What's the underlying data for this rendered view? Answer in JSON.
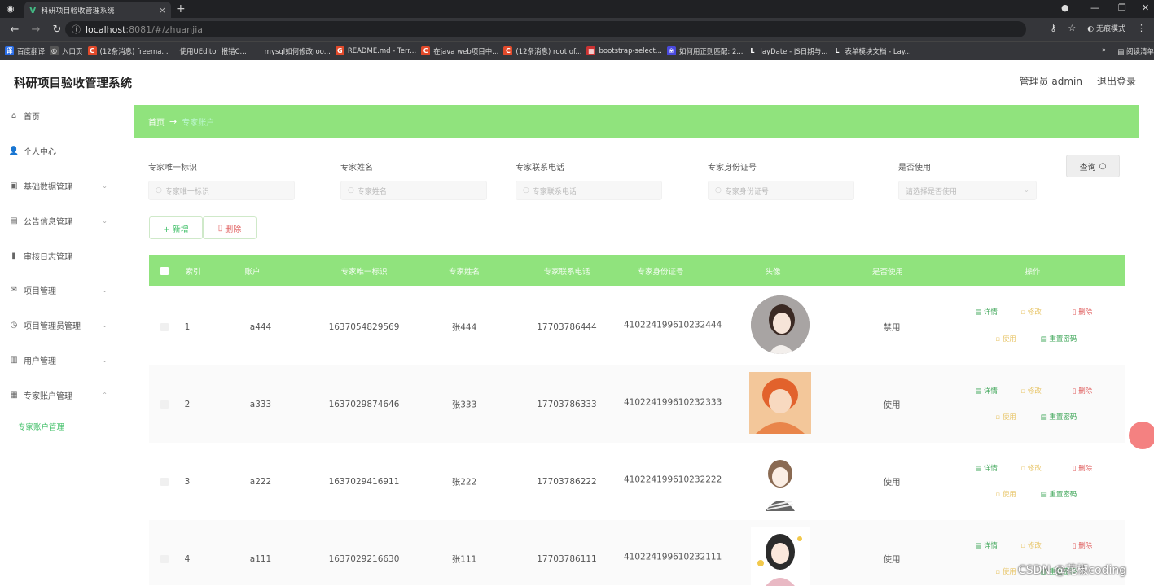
{
  "browser": {
    "tab_title": "科研项目验收管理系统",
    "tab_icon": "V",
    "url_host": "localhost",
    "url_rest": ":8081/#/zhuanjia",
    "incognito_label": "无痕模式",
    "bookmarks": [
      "百度翻译",
      "入口页",
      "(12条消息) freema...",
      "使用UEditor 报错C...",
      "mysql如何修改roo...",
      "README.md - Terr...",
      "在java web项目中...",
      "(12条消息) root of...",
      "bootstrap-select...",
      "如何用正则匹配: 2...",
      "layDate - JS日期与...",
      "表单模块文档 - Lay..."
    ],
    "bookmarks_more": "»",
    "reading_list": "阅读清单"
  },
  "header": {
    "title": "科研项目验收管理系统",
    "user": "管理员 admin",
    "logout": "退出登录"
  },
  "sidebar": {
    "items": [
      {
        "label": "首页",
        "icon": "home-icon"
      },
      {
        "label": "个人中心",
        "icon": "user-icon"
      },
      {
        "label": "基础数据管理",
        "icon": "data-icon"
      },
      {
        "label": "公告信息管理",
        "icon": "notice-icon"
      },
      {
        "label": "审核日志管理",
        "icon": "chart-icon"
      },
      {
        "label": "项目管理",
        "icon": "mail-icon"
      },
      {
        "label": "项目管理员管理",
        "icon": "clock-icon"
      },
      {
        "label": "用户管理",
        "icon": "users-icon"
      },
      {
        "label": "专家账户管理",
        "icon": "expert-icon"
      }
    ],
    "sub_item": "专家账户管理"
  },
  "breadcrumb": {
    "home": "首页",
    "sep": "→",
    "current": "专家账户"
  },
  "search": {
    "fields": [
      {
        "label": "专家唯一标识",
        "placeholder": "专家唯一标识"
      },
      {
        "label": "专家姓名",
        "placeholder": "专家姓名"
      },
      {
        "label": "专家联系电话",
        "placeholder": "专家联系电话"
      },
      {
        "label": "专家身份证号",
        "placeholder": "专家身份证号"
      },
      {
        "label": "是否使用",
        "placeholder": "请选择是否使用"
      }
    ],
    "query_label": "查询"
  },
  "actions": {
    "add": "+ 新增",
    "delete": "删除"
  },
  "table": {
    "headers": [
      "索引",
      "账户",
      "专家唯一标识",
      "专家姓名",
      "专家联系电话",
      "专家身份证号",
      "头像",
      "是否使用",
      "操作"
    ],
    "rows": [
      {
        "index": "1",
        "account": "a444",
        "uid": "1637054829569",
        "name": "张444",
        "phone": "17703786444",
        "idcard": "410224199610232444",
        "status": "禁用"
      },
      {
        "index": "2",
        "account": "a333",
        "uid": "1637029874646",
        "name": "张333",
        "phone": "17703786333",
        "idcard": "410224199610232333",
        "status": "使用"
      },
      {
        "index": "3",
        "account": "a222",
        "uid": "1637029416911",
        "name": "张222",
        "phone": "17703786222",
        "idcard": "410224199610232222",
        "status": "使用"
      },
      {
        "index": "4",
        "account": "a111",
        "uid": "1637029216630",
        "name": "张111",
        "phone": "17703786111",
        "idcard": "410224199610232111",
        "status": "使用"
      }
    ],
    "ops": {
      "detail": "详情",
      "edit": "修改",
      "delete": "删除",
      "use": "使用",
      "reset": "重置密码"
    }
  },
  "watermark": "CSDN @花椒coding"
}
